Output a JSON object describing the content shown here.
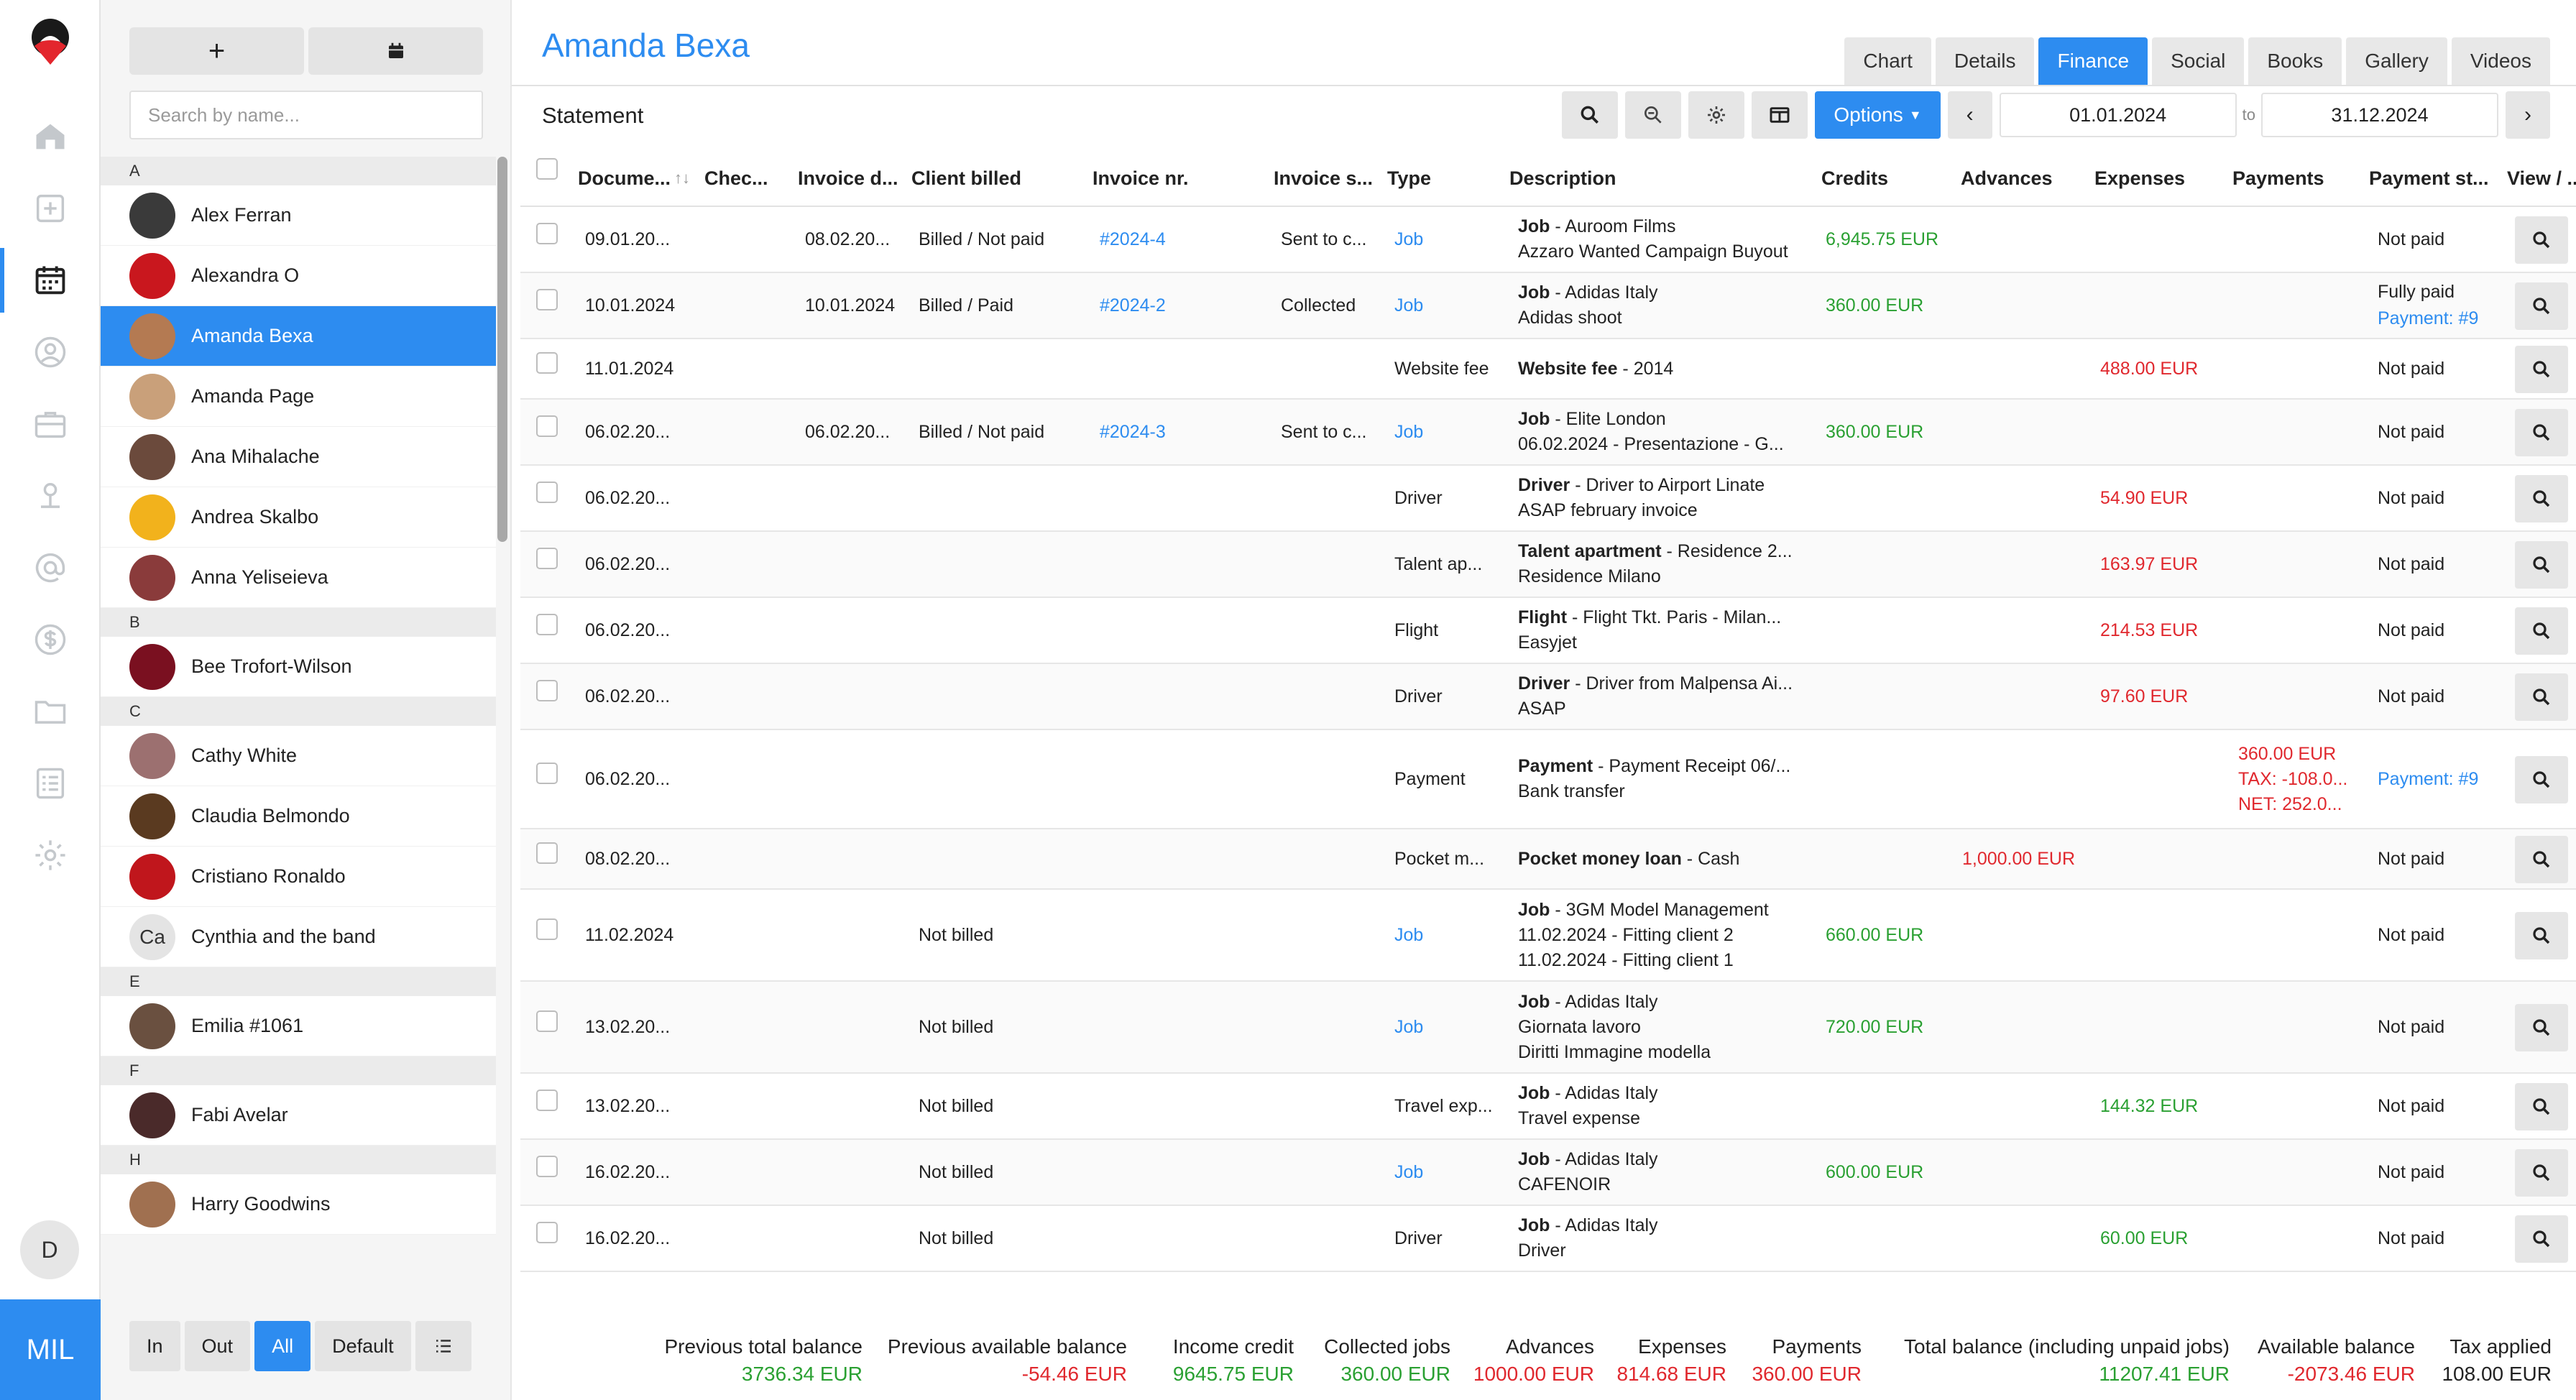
{
  "rail": {
    "brand": "MIL",
    "user_initial": "D"
  },
  "list": {
    "search_placeholder": "Search by name...",
    "sections": [
      {
        "letter": "A",
        "people": [
          {
            "name": "Alex Ferran",
            "color": "#3a3a3a"
          },
          {
            "name": "Alexandra O",
            "color": "#c9171e"
          },
          {
            "name": "Amanda Bexa",
            "color": "#b47a52",
            "active": true
          },
          {
            "name": "Amanda Page",
            "color": "#c9a07a"
          },
          {
            "name": "Ana Mihalache",
            "color": "#6b4a3c"
          },
          {
            "name": "Andrea Skalbo",
            "color": "#f2b21c"
          },
          {
            "name": "Anna Yeliseieva",
            "color": "#8a3b3b"
          }
        ]
      },
      {
        "letter": "B",
        "people": [
          {
            "name": "Bee Trofort-Wilson",
            "color": "#7a1020"
          }
        ]
      },
      {
        "letter": "C",
        "people": [
          {
            "name": "Cathy White",
            "color": "#9c7070"
          },
          {
            "name": "Claudia Belmondo",
            "color": "#5a3a20"
          },
          {
            "name": "Cristiano Ronaldo",
            "color": "#c0161c"
          },
          {
            "name": "Cynthia and the band",
            "initials": "Ca",
            "color": "#e4e4e4"
          }
        ]
      },
      {
        "letter": "E",
        "people": [
          {
            "name": "Emilia #1061",
            "color": "#6a5040"
          }
        ]
      },
      {
        "letter": "F",
        "people": [
          {
            "name": "Fabi Avelar",
            "color": "#4a2a2a"
          }
        ]
      },
      {
        "letter": "H",
        "people": [
          {
            "name": "Harry Goodwins",
            "color": "#a07050"
          }
        ]
      }
    ],
    "filters": [
      "In",
      "Out",
      "All",
      "Default"
    ]
  },
  "main": {
    "title": "Amanda Bexa",
    "tabs": [
      "Chart",
      "Details",
      "Finance",
      "Social",
      "Books",
      "Gallery",
      "Videos"
    ],
    "active_tab": "Finance",
    "subtitle": "Statement",
    "options_label": "Options",
    "date_from": "01.01.2024",
    "date_to_label": "to",
    "date_to": "31.12.2024"
  },
  "table": {
    "headers": [
      "Docume...",
      "Chec...",
      "Invoice d...",
      "Client billed",
      "Invoice nr.",
      "Invoice s...",
      "Type",
      "Description",
      "Credits",
      "Advances",
      "Expenses",
      "Payments",
      "Payment st...",
      "View / ..."
    ],
    "rows": [
      {
        "doc": "09.01.20...",
        "inv_date": "08.02.20...",
        "billed": "Billed / Not paid",
        "inv_nr": "#2024-4",
        "inv_status": "Sent to c...",
        "type": "Job",
        "type_link": true,
        "desc_b": "Job",
        "desc_1": " - Auroom Films",
        "desc_2": "Azzaro Wanted Campaign Buyout",
        "credits": "6,945.75 EUR",
        "pstatus": "Not paid",
        "h": 92
      },
      {
        "doc": "10.01.2024",
        "inv_date": "10.01.2024",
        "billed": "Billed / Paid",
        "inv_nr": "#2024-2",
        "inv_status": "Collected",
        "type": "Job",
        "type_link": true,
        "desc_b": "Job",
        "desc_1": " - Adidas Italy",
        "desc_2": "Adidas shoot",
        "credits": "360.00 EUR",
        "pstatus": "Fully paid",
        "pstatus_link": "Payment: #9",
        "h": 92
      },
      {
        "doc": "11.01.2024",
        "type": "Website fee",
        "desc_b": "Website fee",
        "desc_1": " - 2014",
        "expenses": "488.00 EUR",
        "pstatus": "Not paid",
        "h": 84
      },
      {
        "doc": "06.02.20...",
        "inv_date": "06.02.20...",
        "billed": "Billed / Not paid",
        "inv_nr": "#2024-3",
        "inv_status": "Sent to c...",
        "type": "Job",
        "type_link": true,
        "desc_b": "Job",
        "desc_1": " - Elite London",
        "desc_2": "06.02.2024 - Presentazione - G...",
        "credits": "360.00 EUR",
        "pstatus": "Not paid",
        "h": 92
      },
      {
        "doc": "06.02.20...",
        "type": "Driver",
        "desc_b": "Driver",
        "desc_1": " - Driver to Airport Linate",
        "desc_2": "ASAP february invoice",
        "expenses": "54.90 EUR",
        "pstatus": "Not paid",
        "h": 92
      },
      {
        "doc": "06.02.20...",
        "type": "Talent ap...",
        "desc_b": "Talent apartment",
        "desc_1": " - Residence 2...",
        "desc_2": "Residence Milano",
        "expenses": "163.97 EUR",
        "pstatus": "Not paid",
        "h": 92
      },
      {
        "doc": "06.02.20...",
        "type": "Flight",
        "desc_b": "Flight",
        "desc_1": " - Flight Tkt. Paris - Milan...",
        "desc_2": "Easyjet",
        "expenses": "214.53 EUR",
        "pstatus": "Not paid",
        "h": 92
      },
      {
        "doc": "06.02.20...",
        "type": "Driver",
        "desc_b": "Driver",
        "desc_1": " - Driver from Malpensa Ai...",
        "desc_2": "ASAP",
        "expenses": "97.60 EUR",
        "pstatus": "Not paid",
        "h": 92
      },
      {
        "doc": "06.02.20...",
        "type": "Payment",
        "desc_b": "Payment",
        "desc_1": " - Payment Receipt 06/...",
        "desc_2": "Bank transfer",
        "pay_1": "360.00 EUR",
        "pay_2": "TAX: -108.0...",
        "pay_3": "NET: 252.0...",
        "pstatus_link_only": "Payment: #9",
        "h": 138
      },
      {
        "doc": "08.02.20...",
        "type": "Pocket m...",
        "desc_b": "Pocket money loan",
        "desc_1": " - Cash",
        "advances": "1,000.00 EUR",
        "pstatus": "Not paid",
        "h": 84
      },
      {
        "doc": "11.02.2024",
        "billed": "Not billed",
        "type": "Job",
        "type_link": true,
        "desc_b": "Job",
        "desc_1": " - 3GM Model Management",
        "desc_2": "11.02.2024 - Fitting client 2",
        "desc_3": "11.02.2024 - Fitting client 1",
        "credits": "660.00 EUR",
        "pstatus": "Not paid",
        "h": 128
      },
      {
        "doc": "13.02.20...",
        "billed": "Not billed",
        "type": "Job",
        "type_link": true,
        "desc_b": "Job",
        "desc_1": " - Adidas Italy",
        "desc_2": "Giornata lavoro",
        "desc_3": "Diritti Immagine modella",
        "credits": "720.00 EUR",
        "pstatus": "Not paid",
        "h": 128
      },
      {
        "doc": "13.02.20...",
        "billed": "Not billed",
        "type": "Travel exp...",
        "desc_b": "Job",
        "desc_1": " - Adidas Italy",
        "desc_2": "Travel expense",
        "expenses_green": "144.32 EUR",
        "pstatus": "Not paid",
        "h": 92
      },
      {
        "doc": "16.02.20...",
        "billed": "Not billed",
        "type": "Job",
        "type_link": true,
        "desc_b": "Job",
        "desc_1": " - Adidas Italy",
        "desc_2": "CAFENOIR",
        "credits": "600.00 EUR",
        "pstatus": "Not paid",
        "h": 92
      },
      {
        "doc": "16.02.20...",
        "billed": "Not billed",
        "type": "Driver",
        "desc_b": "Job",
        "desc_1": " - Adidas Italy",
        "desc_2": "Driver",
        "expenses_green": "60.00 EUR",
        "pstatus": "Not paid",
        "h": 92
      }
    ]
  },
  "footer": [
    {
      "label": "Previous total balance",
      "value": "3736.34 EUR",
      "color": "green"
    },
    {
      "label": "Previous available balance",
      "value": "-54.46 EUR",
      "color": "red"
    },
    {
      "label": "Income credit",
      "value": "9645.75 EUR",
      "color": "green"
    },
    {
      "label": "Collected jobs",
      "value": "360.00 EUR",
      "color": "green"
    },
    {
      "label": "Advances",
      "value": "1000.00 EUR",
      "color": "red"
    },
    {
      "label": "Expenses",
      "value": "814.68 EUR",
      "color": "red"
    },
    {
      "label": "Payments",
      "value": "360.00 EUR",
      "color": "red"
    },
    {
      "label": "Total balance (including unpaid jobs)",
      "value": "11207.41 EUR",
      "color": "green"
    },
    {
      "label": "Available balance",
      "value": "-2073.46 EUR",
      "color": "red"
    },
    {
      "label": "Tax applied",
      "value": "108.00 EUR",
      "color": "dark"
    }
  ],
  "colors": {
    "accent": "#2d8cf0",
    "green": "#2aa032",
    "red": "#e0282e"
  }
}
